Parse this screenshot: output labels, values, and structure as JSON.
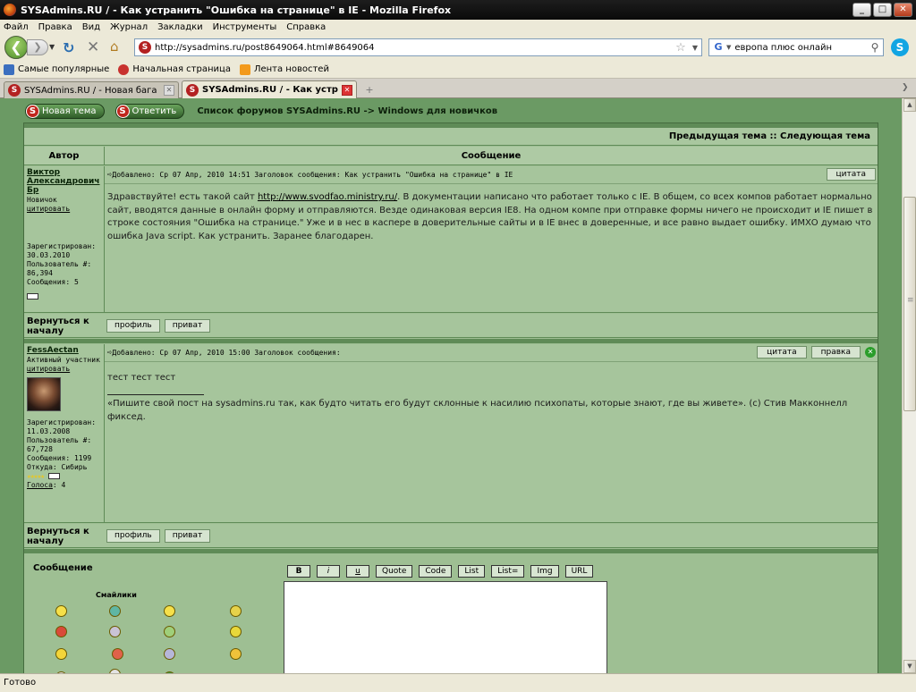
{
  "window": {
    "title": "SYSAdmins.RU / - Как устранить \"Ошибка на странице\" в IE - Mozilla Firefox",
    "minimize": "_",
    "maximize": "□",
    "close": "✕"
  },
  "menu": [
    "Файл",
    "Правка",
    "Вид",
    "Журнал",
    "Закладки",
    "Инструменты",
    "Справка"
  ],
  "nav": {
    "url": "http://sysadmins.ru/post8649064.html#8649064",
    "search_value": "европа плюс онлайн"
  },
  "bookmarks": [
    "Самые популярные",
    "Начальная страница",
    "Лента новостей"
  ],
  "tabs": [
    {
      "label": "SYSAdmins.RU / - Новая бага форума?",
      "active": false
    },
    {
      "label": "SYSAdmins.RU / - Как устранить...",
      "active": true
    }
  ],
  "forum": {
    "new_topic": "Новая тема",
    "reply": "Ответить",
    "breadcrumb": "Список форумов SYSAdmins.RU -> Windows для новичков",
    "prevnext": "Предыдущая тема :: Следующая тема",
    "col_author": "Автор",
    "col_message": "Сообщение",
    "back_to_top": "Вернуться к началу",
    "profile": "профиль",
    "pm": "приват"
  },
  "posts": [
    {
      "author": "Виктор Александрович Бр",
      "rank": "Новичок",
      "quote_link": "цитировать",
      "registered": "Зарегистрирован: 30.03.2010",
      "user_no": "Пользователь #: 86,394",
      "messages": "Сообщения: 5",
      "header": "Добавлено: Ср 07 Апр, 2010 14:51   Заголовок сообщения: Как устранить \"Ошибка на странице\" в IE",
      "quote_btn": "цитата",
      "body_before_link": "Здравствуйте! есть такой сайт ",
      "link": "http://www.svodfao.ministry.ru/",
      "body_after_link": ". В документации написано что работает только с IE. В общем, со всех компов работает нормально сайт, вводятся данные в онлайн форму и отправляются. Везде одинаковая версия IE8. На одном компе при отправке формы ничего не происходит и IE пишет в строке состояния \"Ошибка на странице.\" Уже и в нес в каспере в доверительные сайты и в IE внес в доверенные, и все равно выдает ошибку. ИМХО думаю что ошибка Java script. Как устранить. Заранее благодарен."
    },
    {
      "author": "FessAectan",
      "rank": "Активный участник",
      "quote_link": "цитировать",
      "registered": "Зарегистрирован: 11.03.2008",
      "user_no": "Пользователь #: 67,728",
      "messages": "Сообщения: 1199",
      "location": "Откуда: Сибирь",
      "votes_label": "Голоса",
      "votes": ": 4",
      "header": "Добавлено: Ср 07 Апр, 2010 15:00   Заголовок сообщения:",
      "quote_btn": "цитата",
      "edit_btn": "правка",
      "body": "тест тест тест",
      "signature": "«Пишите свой пост на sysadmins.ru так, как будто читать его будут склонные к насилию психопаты, которые знают, где вы живете». (c) Стив Макконнелл фиксед."
    }
  ],
  "reply_form": {
    "title": "Сообщение",
    "smiles_title": "Смайлики",
    "buttons": [
      "B",
      "i",
      "u",
      "Quote",
      "Code",
      "List",
      "List=",
      "Img",
      "URL"
    ]
  },
  "status": "Готово",
  "colors": {
    "page_green": "#6b9a64",
    "panel_green": "#9ebf93",
    "border_green": "#5f8b57"
  }
}
